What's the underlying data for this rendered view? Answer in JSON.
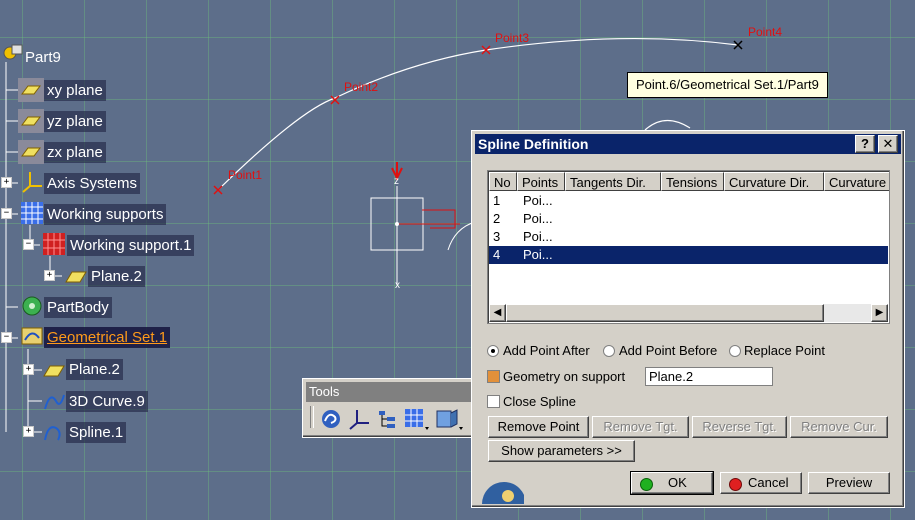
{
  "tree": {
    "root": "Part9",
    "items": [
      {
        "label": "xy plane"
      },
      {
        "label": "yz plane"
      },
      {
        "label": "zx plane"
      },
      {
        "label": "Axis Systems"
      },
      {
        "label": "Working supports"
      },
      {
        "label": "Working support.1"
      },
      {
        "label": "Plane.2"
      },
      {
        "label": "PartBody"
      },
      {
        "label": "Geometrical Set.1"
      },
      {
        "label": "Plane.2"
      },
      {
        "label": "3D Curve.9"
      },
      {
        "label": "Spline.1"
      }
    ],
    "expander_plus": "+",
    "expander_minus": "−"
  },
  "viewport": {
    "points": [
      "Point1",
      "Point2",
      "Point3",
      "Point4"
    ],
    "tooltip": "Point.6/Geometrical Set.1/Part9",
    "axis_z": "z",
    "axis_x": "x"
  },
  "toolbar": {
    "title": "Tools"
  },
  "dialog": {
    "title": "Spline Definition",
    "help_label": "?",
    "close_label": "✕",
    "columns": [
      "No",
      "Points",
      "Tangents Dir.",
      "Tensions",
      "Curvature Dir.",
      "Curvature"
    ],
    "rows": [
      {
        "no": "1",
        "point": "Poi..."
      },
      {
        "no": "2",
        "point": "Poi..."
      },
      {
        "no": "3",
        "point": "Poi..."
      },
      {
        "no": "4",
        "point": "Poi..."
      }
    ],
    "selected_row": 4,
    "radio_add_after": "Add Point After",
    "radio_add_before": "Add Point Before",
    "radio_replace": "Replace Point",
    "geometry_on_support_label": "Geometry on support",
    "geometry_on_support_value": "Plane.2",
    "close_spline_label": "Close Spline",
    "buttons": {
      "remove_point": "Remove Point",
      "remove_tgt": "Remove Tgt.",
      "reverse_tgt": "Reverse Tgt.",
      "remove_cur": "Remove Cur.",
      "show_parameters": "Show parameters >>",
      "ok": "OK",
      "cancel": "Cancel",
      "preview": "Preview"
    }
  },
  "colors": {
    "background": "#5d6e8a",
    "grid": "#6ec878",
    "selection": "#0a246a",
    "highlight": "#ff9a1a",
    "point_label": "#e01010",
    "dialog_face": "#d4d0c8"
  }
}
